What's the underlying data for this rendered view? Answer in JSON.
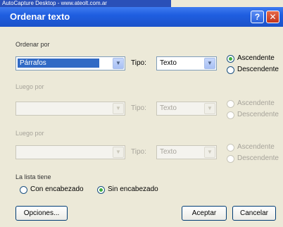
{
  "caption_strip": "AutoCapture Desktop - www.ateolt.com.ar",
  "dialog": {
    "title": "Ordenar texto"
  },
  "sections": {
    "first": {
      "label": "Ordenar por",
      "field_value": "Párrafos",
      "type_label": "Tipo:",
      "type_value": "Texto",
      "order_options": [
        "Ascendente",
        "Descendente"
      ],
      "selected_order": "Ascendente"
    },
    "second": {
      "label": "Luego por",
      "field_value": "",
      "type_label": "Tipo:",
      "type_value": "Texto",
      "order_options": [
        "Ascendente",
        "Descendente"
      ]
    },
    "third": {
      "label": "Luego por",
      "field_value": "",
      "type_label": "Tipo:",
      "type_value": "Texto",
      "order_options": [
        "Ascendente",
        "Descendente"
      ]
    }
  },
  "list_has": {
    "label": "La lista tiene",
    "options": [
      "Con encabezado",
      "Sin encabezado"
    ],
    "selected": "Sin encabezado"
  },
  "buttons": {
    "options": "Opciones...",
    "ok": "Aceptar",
    "cancel": "Cancelar"
  },
  "colors": {
    "title_bar": "#1f5ee0",
    "dialog_bg": "#ece9d8",
    "selection": "#316ac5",
    "radio_dot": "#3fae3f"
  }
}
